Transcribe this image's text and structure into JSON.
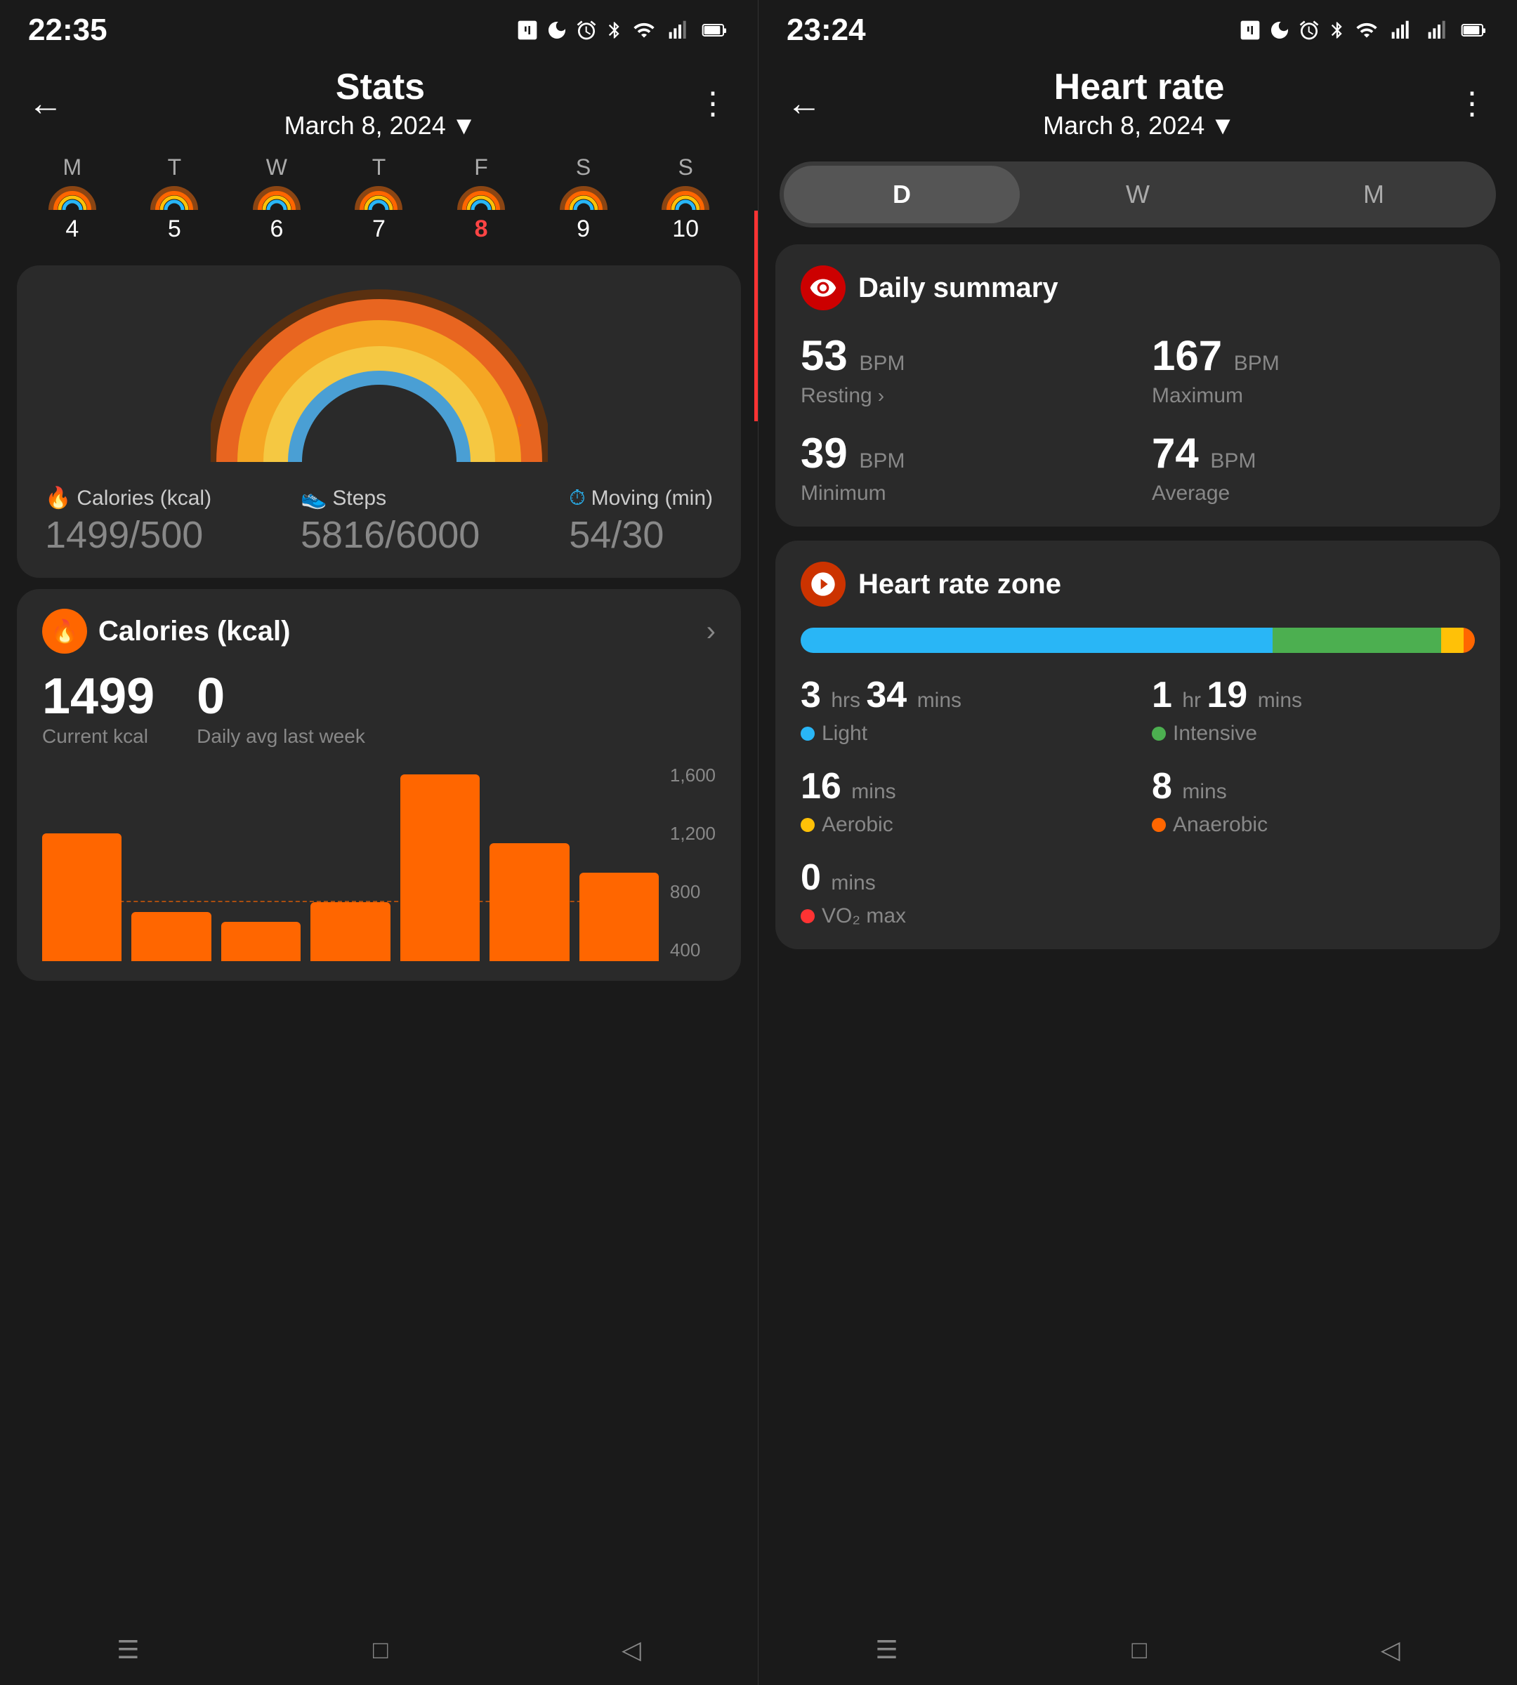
{
  "left": {
    "status_time": "22:35",
    "status_icons": "N ☾ ⏰ ✦ ⊕ ▐▐▐▌ 🔋",
    "header": {
      "title": "Stats",
      "date": "March 8, 2024",
      "back_label": "←",
      "menu_label": "⋮"
    },
    "week": {
      "days": [
        {
          "label": "M",
          "num": "4",
          "active": false
        },
        {
          "label": "T",
          "num": "5",
          "active": false
        },
        {
          "label": "W",
          "num": "6",
          "active": false
        },
        {
          "label": "T",
          "num": "7",
          "active": false
        },
        {
          "label": "F",
          "num": "8",
          "active": true
        },
        {
          "label": "S",
          "num": "9",
          "active": false
        },
        {
          "label": "S",
          "num": "10",
          "active": false
        }
      ]
    },
    "stats": {
      "calories_label": "🔥 Calories (kcal)",
      "calories_value": "1499",
      "calories_goal": "500",
      "steps_label": "👟 Steps",
      "steps_value": "5816",
      "steps_goal": "6000",
      "moving_label": "Moving (min)",
      "moving_value": "54",
      "moving_goal": "30"
    },
    "calories_section": {
      "title": "Calories (kcal)",
      "current_value": "1499",
      "current_label": "Current kcal",
      "avg_value": "0",
      "avg_label": "Daily avg last week"
    },
    "chart": {
      "y_labels": [
        "1,600",
        "1,200",
        "800",
        "400"
      ],
      "bars": [
        0.65,
        0.25,
        0.2,
        0.3,
        0.95,
        0.6,
        0.45
      ]
    },
    "bottom_nav": [
      "☰",
      "□",
      "◁"
    ]
  },
  "right": {
    "status_time": "23:24",
    "status_icons": "N ☾ ⏰ ✦ ⊕ ▐▐▐▌ 🔋",
    "header": {
      "title": "Heart rate",
      "date": "March 8, 2024",
      "back_label": "←",
      "menu_label": "⋮"
    },
    "tabs": [
      {
        "label": "D",
        "active": true
      },
      {
        "label": "W",
        "active": false
      },
      {
        "label": "M",
        "active": false
      }
    ],
    "daily_summary": {
      "title": "Daily summary",
      "resting_value": "53",
      "resting_label": "Resting",
      "maximum_value": "167",
      "maximum_label": "Maximum",
      "minimum_value": "39",
      "minimum_label": "Minimum",
      "average_value": "74",
      "average_label": "Average",
      "bpm": "BPM"
    },
    "heart_rate_zone": {
      "title": "Heart rate zone",
      "light_hrs": "3",
      "light_mins": "34",
      "light_label": "Light",
      "intensive_hrs": "1",
      "intensive_mins": "19",
      "intensive_label": "Intensive",
      "aerobic_mins": "16",
      "aerobic_label": "Aerobic",
      "anaerobic_mins": "8",
      "anaerobic_label": "Anaerobic",
      "vo2_mins": "0",
      "vo2_label": "VO₂ max",
      "colors": {
        "light": "#29b6f6",
        "intensive": "#4caf50",
        "aerobic": "#ffc107",
        "anaerobic": "#ff6600",
        "vo2": "#ff3333"
      }
    },
    "bottom_nav": [
      "☰",
      "□",
      "◁"
    ]
  }
}
